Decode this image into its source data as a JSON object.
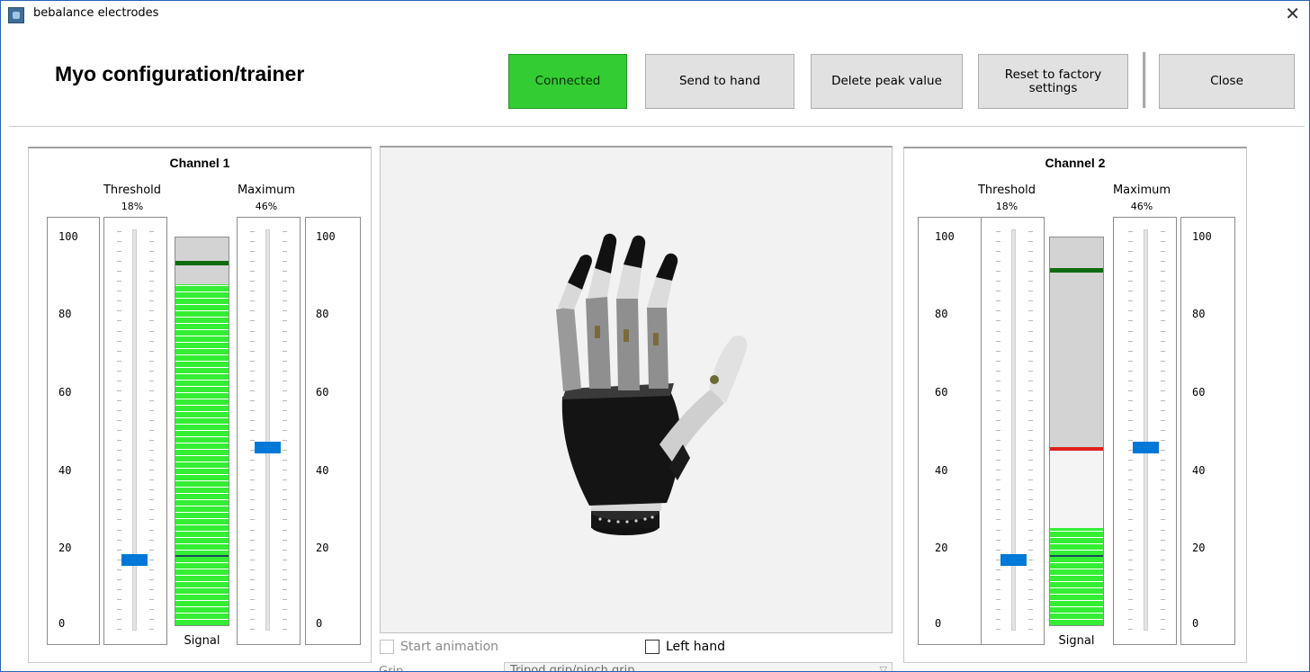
{
  "window": {
    "title": "bebalance electrodes",
    "close_glyph": "✕",
    "icon": "app-icon"
  },
  "header": {
    "title": "Myo configuration/trainer"
  },
  "toolbar": {
    "connected_label": "Connected",
    "send_label": "Send to hand",
    "delete_label": "Delete peak value",
    "reset_label": "Reset to factory settings",
    "close_label": "Close",
    "connected_color": "#33cc33"
  },
  "channels": [
    {
      "title": "Channel 1",
      "threshold_label": "Threshold",
      "threshold_pct": "18%",
      "threshold_value": 18,
      "maximum_label": "Maximum",
      "maximum_pct": "46%",
      "maximum_value": 46,
      "signal_label": "Signal",
      "signal_level": 88,
      "peak_level": 94,
      "red_level": null,
      "scale": [
        "100",
        "80",
        "60",
        "40",
        "20",
        "0"
      ]
    },
    {
      "title": "Channel 2",
      "threshold_label": "Threshold",
      "threshold_pct": "18%",
      "threshold_value": 18,
      "maximum_label": "Maximum",
      "maximum_pct": "46%",
      "maximum_value": 46,
      "signal_label": "Signal",
      "signal_level": 25,
      "peak_level": 92,
      "red_level": 46,
      "scale": [
        "100",
        "80",
        "60",
        "40",
        "20",
        "0"
      ]
    }
  ],
  "viewer": {
    "image": "bionic-hand-3d-model"
  },
  "options": {
    "start_animation": "Start animation",
    "left_hand": "Left hand"
  },
  "grip": {
    "label": "Grip",
    "value": "Tripod grip/pinch grip"
  }
}
